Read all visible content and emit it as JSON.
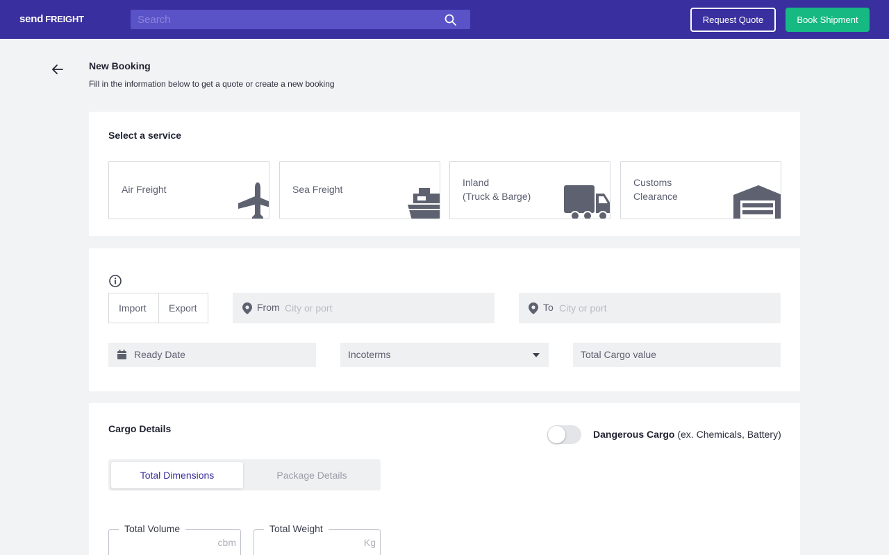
{
  "topbar": {
    "logo_send": "send",
    "logo_freight": "FREIGHT",
    "search_placeholder": "Search",
    "request_quote": "Request Quote",
    "book_shipment": "Book Shipment"
  },
  "header": {
    "title": "New Booking",
    "subtitle": "Fill in the information below to get a quote or create a new booking"
  },
  "service_section": {
    "title": "Select a service",
    "services": [
      {
        "line1": "Air Freight",
        "line2": "",
        "icon": "airplane-icon"
      },
      {
        "line1": "Sea Freight",
        "line2": "",
        "icon": "ship-icon"
      },
      {
        "line1": "Inland",
        "line2": "(Truck & Barge)",
        "icon": "truck-icon"
      },
      {
        "line1": "Customs",
        "line2": "Clearance",
        "icon": "warehouse-icon"
      }
    ]
  },
  "route": {
    "import_label": "Import",
    "export_label": "Export",
    "from_label": "From",
    "from_placeholder": "City or port",
    "to_label": "To",
    "to_placeholder": "City or port",
    "ready_date": "Ready Date",
    "incoterms": "Incoterms",
    "cargo_value": "Total Cargo value"
  },
  "cargo": {
    "title": "Cargo Details",
    "dangerous_bold": "Dangerous Cargo",
    "dangerous_rest": " (ex. Chemicals, Battery)",
    "dangerous_on": false,
    "tab_total": "Total Dimensions",
    "tab_package": "Package Details",
    "volume_label": "Total Volume",
    "volume_unit": "cbm",
    "weight_label": "Total Weight",
    "weight_unit": "Kg"
  },
  "colors": {
    "brand": "#3a2f9e",
    "accent_green": "#16b982",
    "search_bg": "#5a52c7"
  }
}
